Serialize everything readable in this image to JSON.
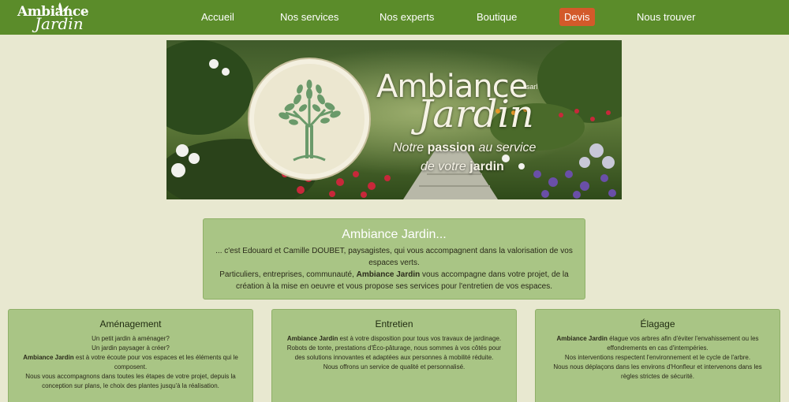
{
  "brand": {
    "logo_line1": "Ambiance",
    "logo_line2": "Jardin",
    "logo_suffix": "sarl"
  },
  "nav": {
    "items": [
      {
        "label": "Accueil"
      },
      {
        "label": "Nos services"
      },
      {
        "label": "Nos experts"
      },
      {
        "label": "Boutique"
      },
      {
        "label": "Devis",
        "highlight": true
      },
      {
        "label": "Nous trouver"
      }
    ]
  },
  "hero": {
    "title_line1": "Ambiance",
    "title_line2": "Jardin",
    "suffix": "sarl",
    "tagline_part1": "Notre ",
    "tagline_bold1": "passion",
    "tagline_part2": " au service",
    "tagline_part3": "de votre ",
    "tagline_bold2": "jardin"
  },
  "intro": {
    "title": "Ambiance Jardin...",
    "p1": "... c'est Edouard et Camille DOUBET, paysagistes, qui vous accompagnent dans la valorisation de vos espaces verts.",
    "p2_before": "Particuliers, entreprises, communauté, ",
    "p2_bold": "Ambiance Jardin",
    "p2_after": " vous accompagne dans votre projet, de la création à la mise en oeuvre et vous propose ses services pour l'entretien de vos espaces."
  },
  "cards": [
    {
      "title": "Aménagement",
      "l1": "Un petit jardin à aménager?",
      "l2": "Un jardin paysager à créer?",
      "l3_bold": "Ambiance Jardin",
      "l3_after": " est à votre écoute pour vos espaces et les éléments qui le composent.",
      "l4": "Nous vous accompagnons dans toutes les étapes de votre projet, depuis la conception sur plans, le choix des plantes jusqu'à la réalisation."
    },
    {
      "title": "Entretien",
      "l1_bold": "Ambiance Jardin",
      "l1_after": " est à votre disposition pour tous vos travaux de jardinage.",
      "l2": "Robots de tonte, prestations d'Éco-pâturage, nous sommes à vos côtés pour des solutions innovantes et adaptées aux personnes à mobilité réduite.",
      "l3": "Nous offrons un service de qualité et personnalisé."
    },
    {
      "title": "Élagage",
      "l1_bold": "Ambiance Jardin",
      "l1_after": " élague vos arbres afin d'éviter l'envahissement ou les effondrements en cas d'intempéries.",
      "l2": "Nos interventions respectent l'environnement et le cycle de l'arbre.",
      "l3": "Nous nous déplaçons dans les environs d'Honfleur et intervenons dans les règles strictes de sécurité."
    }
  ],
  "colors": {
    "nav_bg": "#5b8c2a",
    "devis_bg": "#d35a2a",
    "page_bg": "#e8e8d0",
    "box_bg": "#a9c585"
  }
}
